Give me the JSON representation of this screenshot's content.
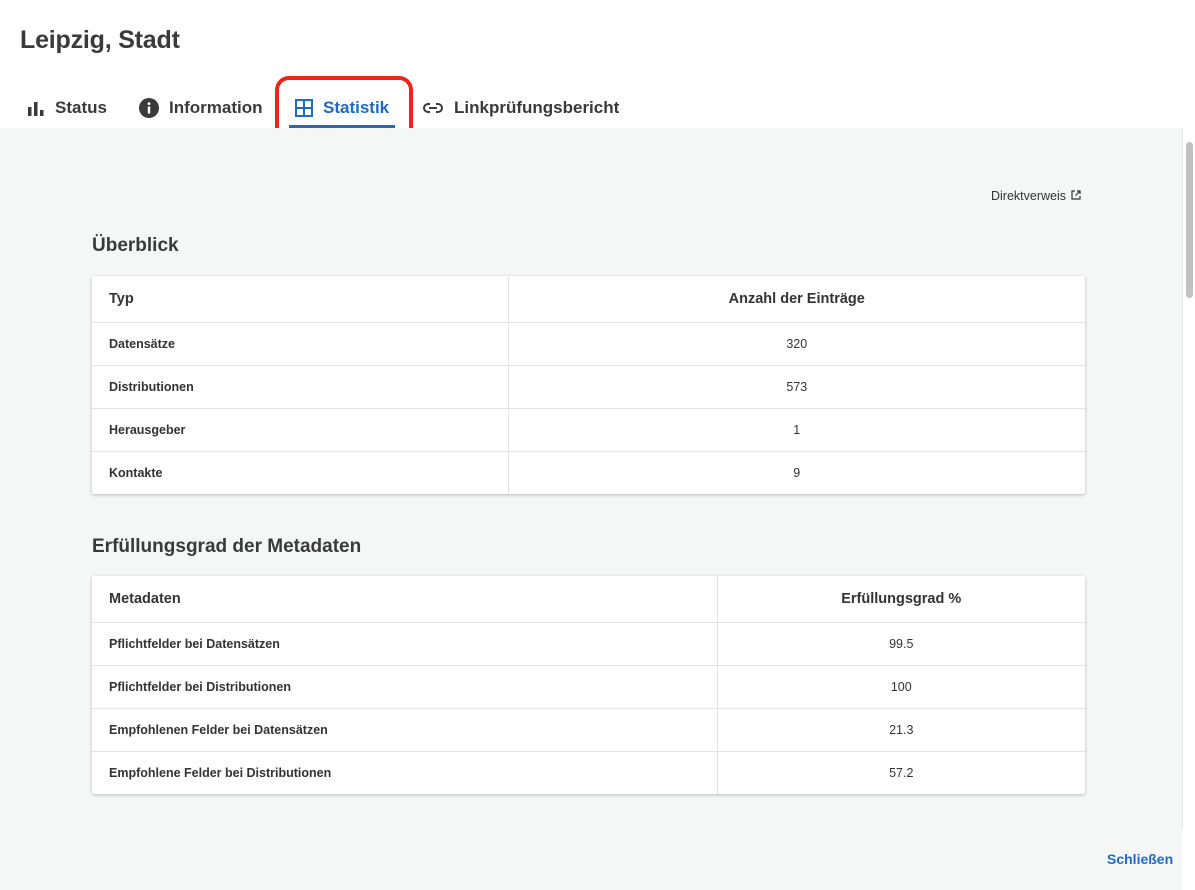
{
  "title": "Leipzig, Stadt",
  "tabs": [
    {
      "label": "Status",
      "icon": "bar-chart-icon",
      "active": false
    },
    {
      "label": "Information",
      "icon": "info-icon",
      "active": false
    },
    {
      "label": "Statistik",
      "icon": "table-grid-icon",
      "active": true
    },
    {
      "label": "Linkprüfungsbericht",
      "icon": "link-icon",
      "active": false
    }
  ],
  "direct_link": {
    "label": "Direktverweis",
    "icon": "external-link-icon"
  },
  "overview": {
    "title": "Überblick",
    "headers": [
      "Typ",
      "Anzahl der Einträge"
    ],
    "rows": [
      {
        "label": "Datensätze",
        "value": "320"
      },
      {
        "label": "Distributionen",
        "value": "573"
      },
      {
        "label": "Herausgeber",
        "value": "1"
      },
      {
        "label": "Kontakte",
        "value": "9"
      }
    ]
  },
  "metadata": {
    "title": "Erfüllungsgrad der Metadaten",
    "headers": [
      "Metadaten",
      "Erfüllungsgrad %"
    ],
    "rows": [
      {
        "label": "Pflichtfelder bei Datensätzen",
        "value": "99.5"
      },
      {
        "label": "Pflichtfelder bei Distributionen",
        "value": "100"
      },
      {
        "label": "Empfohlenen Felder bei Datensätzen",
        "value": "21.3"
      },
      {
        "label": "Empfohlene Felder bei Distributionen",
        "value": "57.2"
      }
    ]
  },
  "close_label": "Schließen",
  "colors": {
    "accent": "#1e6ac4",
    "highlight": "#e8261b",
    "background": "#f5f6f6"
  }
}
